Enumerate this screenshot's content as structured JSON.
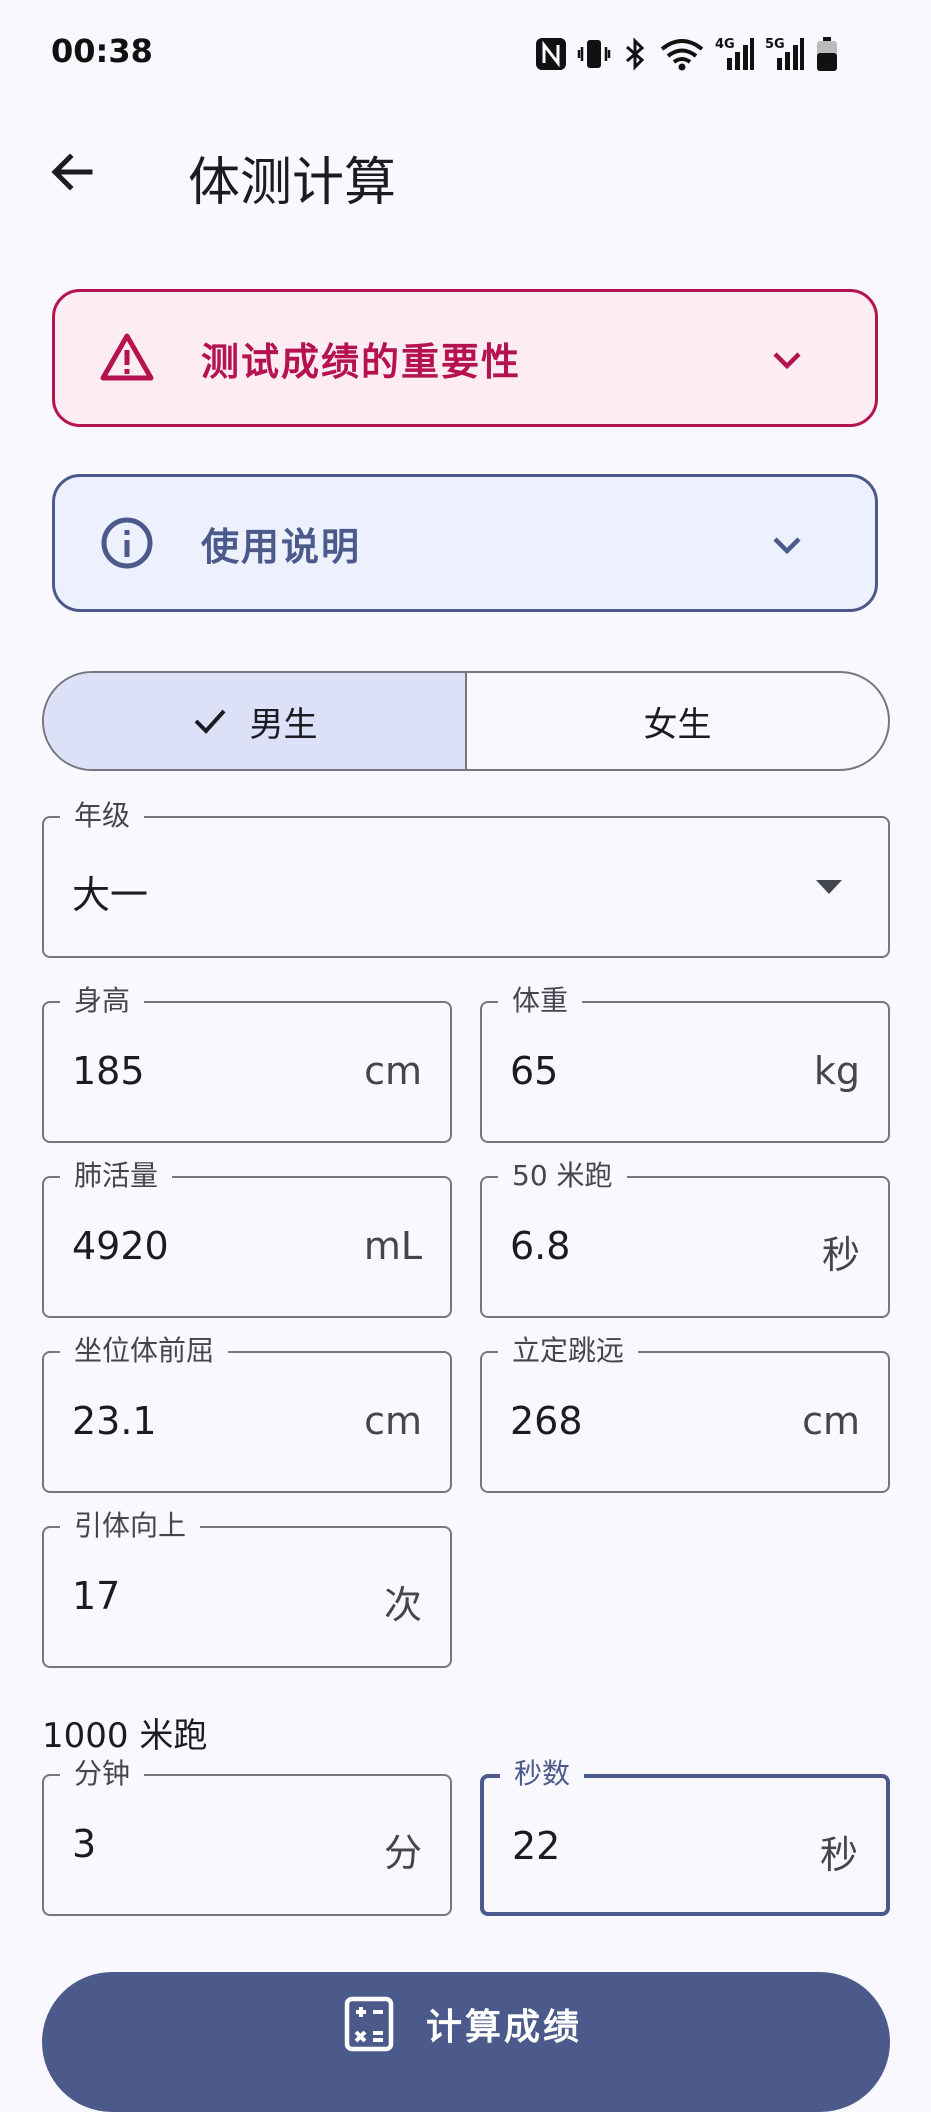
{
  "status_bar": {
    "time": "00:38",
    "icons": [
      "nfc-icon",
      "vibrate-icon",
      "bluetooth-icon",
      "wifi-icon",
      "signal-4g-icon",
      "signal-5g-icon",
      "battery-icon"
    ],
    "net_4g": "4G",
    "net_5g": "5G"
  },
  "app_bar": {
    "title": "体测计算",
    "back_icon": "back-arrow-icon"
  },
  "cards": {
    "warning": {
      "label": "测试成绩的重要性",
      "icon": "warning-triangle-icon",
      "color": "#b5134f"
    },
    "info": {
      "label": "使用说明",
      "icon": "info-circle-icon",
      "color": "#4c5a8b"
    }
  },
  "gender": {
    "male": "男生",
    "female": "女生",
    "selected": "男生"
  },
  "grade": {
    "label": "年级",
    "value": "大一"
  },
  "fields": {
    "height": {
      "label": "身高",
      "value": "185",
      "unit": "cm"
    },
    "weight": {
      "label": "体重",
      "value": "65",
      "unit": "kg"
    },
    "lung": {
      "label": "肺活量",
      "value": "4920",
      "unit": "mL"
    },
    "run50": {
      "label": "50 米跑",
      "value": "6.8",
      "unit": "秒"
    },
    "sitreach": {
      "label": "坐位体前屈",
      "value": "23.1",
      "unit": "cm"
    },
    "jump": {
      "label": "立定跳远",
      "value": "268",
      "unit": "cm"
    },
    "pullup": {
      "label": "引体向上",
      "value": "17",
      "unit": "次"
    }
  },
  "run1000": {
    "section": "1000 米跑",
    "minutes": {
      "label": "分钟",
      "value": "3",
      "unit": "分"
    },
    "seconds": {
      "label": "秒数",
      "value": "22",
      "unit": "秒"
    }
  },
  "calc_button": {
    "label": "计算成绩",
    "icon": "calculator-icon"
  },
  "colors": {
    "primary": "#4c5a8b",
    "error": "#b5134f",
    "background": "#f8f8fe"
  }
}
